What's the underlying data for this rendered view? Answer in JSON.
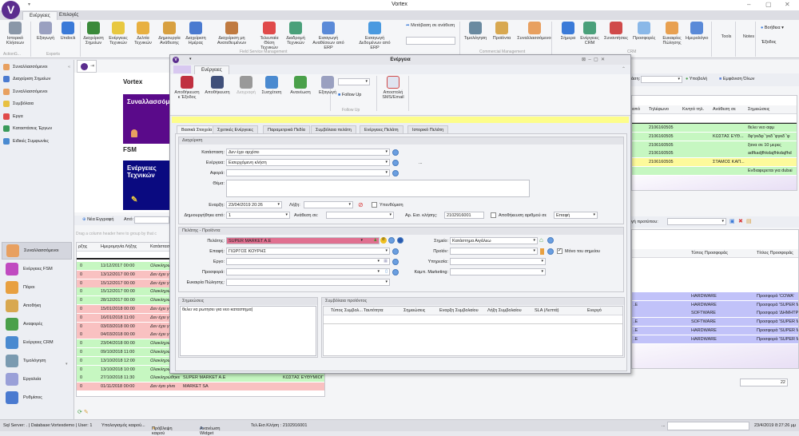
{
  "app": {
    "title": "Vortex",
    "logo": "V"
  },
  "ribbon": {
    "tabs": [
      "Ενέργειες",
      "Επιλογές"
    ],
    "buttons": [
      {
        "label": "Ιστορικό Κλήσεων",
        "icon": "phone-icon",
        "color": "#8a97a8"
      },
      {
        "label": "Εξαγωγή",
        "icon": "database-export-icon",
        "color": "#9aa0c0"
      },
      {
        "label": "Undock",
        "icon": "undock-icon",
        "color": "#3a7ad8"
      },
      {
        "label": "Διαχείριση Σημείων",
        "icon": "org-chart-icon",
        "color": "#3a8a3a"
      },
      {
        "label": "Ενέργειες Τεχνικών",
        "icon": "tools-icon",
        "color": "#e8c840"
      },
      {
        "label": "Δελτία Τεχνικών",
        "icon": "clipboard-icon",
        "color": "#e8b040"
      },
      {
        "label": "Δημιουργία Ανάθεσης",
        "icon": "assign-icon",
        "color": "#d8a040"
      },
      {
        "label": "Διαχείριση Ημέρας",
        "icon": "day-list-icon",
        "color": "#4a7ad0"
      },
      {
        "label": "Διαχείριση μη Ανατεθειμένων",
        "icon": "user-question-icon",
        "color": "#c07a40"
      },
      {
        "label": "Τελευταία Θέση Τεχνικών",
        "icon": "map-pin-icon",
        "color": "#e04a4a"
      },
      {
        "label": "Διαδρομή Τεχνικών",
        "icon": "globe-icon",
        "color": "#4aa07a"
      },
      {
        "label": "Εισαγωγή Αναθέσεων από ERP",
        "icon": "import-doc-icon",
        "color": "#5a8ad8"
      },
      {
        "label": "Εισαγωγή Δεδομένων από ERP",
        "icon": "cloud-download-icon",
        "color": "#4a9ae0"
      },
      {
        "label": "Τιμολόγηση",
        "icon": "printer-icon",
        "color": "#6a8aa0"
      },
      {
        "label": "Προϊόντα",
        "icon": "box-icon",
        "color": "#d8a850"
      },
      {
        "label": "Συναλλασσόμενοι",
        "icon": "person-icon",
        "color": "#e8a060"
      },
      {
        "label": "Σήμερα",
        "icon": "clock-icon",
        "color": "#3a7ad8"
      },
      {
        "label": "Ενέργειες CRM",
        "icon": "workflow-icon",
        "color": "#4aa07a"
      },
      {
        "label": "Συναντήσεις",
        "icon": "calendar-check-icon",
        "color": "#d04a4a"
      },
      {
        "label": "Προσφορές",
        "icon": "document-icon",
        "color": "#8ab8e8"
      },
      {
        "label": "Ευκαιρίες Πώλησης",
        "icon": "handshake-icon",
        "color": "#e8a050"
      },
      {
        "label": "Ημερολόγιο",
        "icon": "calendar-icon",
        "color": "#5a8ad8"
      },
      {
        "label": "Tools",
        "icon": "",
        "color": ""
      },
      {
        "label": "Notes",
        "icon": "",
        "color": ""
      }
    ],
    "groups": [
      "ActionG...",
      "Exports",
      "Field Service Management",
      "Commercial Management",
      "CRM"
    ],
    "transfer_label": "Μετάβαση σε ανάθεση",
    "help_label": "Βοήθεια",
    "exit_label": "Έξοδος"
  },
  "leftnav": {
    "header": "Συναλλασσόμενοι",
    "items": [
      {
        "label": "Διαχείριση Σημείων",
        "color": "#4a7ad0"
      },
      {
        "label": "Συναλλασσόμενοι",
        "color": "#e8a060"
      },
      {
        "label": "Συμβόλαια",
        "color": "#e8c040"
      },
      {
        "label": "Εργα",
        "color": "#e04a4a"
      },
      {
        "label": "Καταστάσεις Έργων",
        "color": "#3a9a5a"
      },
      {
        "label": "Ειδικές Συμφωνίες",
        "color": "#4a8ad0"
      }
    ],
    "modules": [
      {
        "label": "Συναλλασσόμενοι",
        "color": "#e8a060"
      },
      {
        "label": "Ενέργειες FSM",
        "color": "#c04ac0"
      },
      {
        "label": "Πόροι",
        "color": "#e8a040"
      },
      {
        "label": "Αποθήκη",
        "color": "#d8a850"
      },
      {
        "label": "Αναφορές",
        "color": "#4aa04a"
      },
      {
        "label": "Ενέργειες CRM",
        "color": "#4a8ad0"
      },
      {
        "label": "Τιμολόγηση",
        "color": "#7a9ab0"
      },
      {
        "label": "Εργαλεία",
        "color": "#9aa0d8"
      },
      {
        "label": "Ρυθμίσεις",
        "color": "#4a7ad0"
      }
    ]
  },
  "dashboard": {
    "vortex_heading": "Vortex",
    "tile1": "Συναλλασσόμε",
    "fsm_heading": "FSM",
    "tile2": "Ενέργειες Τεχνικών",
    "new_record": "Νέα Εγγραφή",
    "from_label": "Από:",
    "group_hint": "Drag a column header here to group by that c"
  },
  "left_grid": {
    "headers": [
      "ρξης",
      "Ημερομηνία Λήξης",
      "Κατάσταση"
    ],
    "rows": [
      {
        "c0": "0",
        "date": "11/12/2017 00:00",
        "status": "Ολοκληρώ",
        "status_color": "green"
      },
      {
        "c0": "0",
        "date": "13/12/2017 00:00",
        "status": "Δεν έχει γ",
        "status_color": "red"
      },
      {
        "c0": "0",
        "date": "15/12/2017 00:00",
        "status": "Δεν έχει γ",
        "status_color": "red"
      },
      {
        "c0": "0",
        "date": "15/12/2017 00:00",
        "status": "Ολοκληρώ",
        "status_color": "green"
      },
      {
        "c0": "0",
        "date": "28/12/2017 00:00",
        "status": "Ολοκληρώ",
        "status_color": "green"
      },
      {
        "c0": "0",
        "date": "15/01/2018 00:00",
        "status": "Δεν έχει γ",
        "status_color": "red"
      },
      {
        "c0": "0",
        "date": "16/01/2018 11:00",
        "status": "Δεν έχει γ",
        "status_color": "red"
      },
      {
        "c0": "0",
        "date": "03/03/2018 00:00",
        "status": "Δεν έχει γ",
        "status_color": "red"
      },
      {
        "c0": "0",
        "date": "04/03/2018 00:00",
        "status": "Δεν έχει γ",
        "status_color": "red"
      },
      {
        "c0": "0",
        "date": "23/04/2018 00:00",
        "status": "Ολοκληρώ",
        "status_color": "green"
      },
      {
        "c0": "0",
        "date": "09/10/2018 11:00",
        "status": "Ολοκληρώ",
        "status_color": "green"
      },
      {
        "c0": "0",
        "date": "13/10/2018 12:00",
        "status": "Ολοκληρώ",
        "status_color": "green"
      },
      {
        "c0": "0",
        "date": "13/10/2018 10:00",
        "status": "Ολοκληρώ",
        "status_color": "green"
      },
      {
        "c0": "0",
        "date": "27/10/2018 11:30",
        "status": "Ολοκληρώθηκε",
        "status_color": "green",
        "customer": "SUPER MARKET A.E",
        "assignee": "ΚΩΣΤΑΣ ΕΥΘΥΜΙΟΓ"
      },
      {
        "c0": "0",
        "date": "01/11/2018 00:00",
        "status": "Δεν έγει γίνει",
        "status_color": "red",
        "customer": "MARKET SA",
        "assignee": ""
      }
    ]
  },
  "right_grid": {
    "filter_label": "άση:",
    "submit": "Υποβολή",
    "show_all": "Εμφάνιση Όλων",
    "headers": [
      "από",
      "Τηλέφωνο",
      "Κινητό τηλ.",
      "Ανάθεση σε",
      "Σημειώσεις"
    ],
    "rows": [
      {
        "phone": "2106160505",
        "assignee": "",
        "notes": "θελει νεο αφμ",
        "color": "green"
      },
      {
        "phone": "2106160505",
        "assignee": "ΚΩΣΤΑΣ ΕΥΘ...",
        "notes": "δφ'γκδφ΄'γκδ΄'φγκδ΄'φ",
        "color": "green"
      },
      {
        "phone": "2106160505",
        "assignee": "",
        "notes": "ξανα σε 10 μερες",
        "color": "green"
      },
      {
        "phone": "2106160505",
        "assignee": "",
        "notes": "adfkadjfhkdajfhkdajfhd",
        "color": "green"
      },
      {
        "phone": "2106160505",
        "assignee": "ΣΤΑΜΟΣ ΚΑΠ...",
        "notes": "",
        "color": "yellow"
      },
      {
        "phone": "",
        "assignee": "",
        "notes": "Ενδιαφερεται για dubai",
        "color": "green"
      }
    ]
  },
  "offers_grid": {
    "template_label": "γή προτύπου:",
    "headers": [
      "Τύπος Προσφοράς",
      "Τίτλος Προσφοράς"
    ],
    "rows": [
      {
        "c0": "",
        "type": "HARDWARE",
        "title": "Προσφορά 'COWA'"
      },
      {
        "c0": ".E",
        "type": "HARDWARE",
        "title": "Προσφορά 'SUPER MAR"
      },
      {
        "c0": "",
        "type": "SOFTWARE",
        "title": "Προσφορά 'ΔΗΜΗΤΡΗΣ"
      },
      {
        "c0": ".E",
        "type": "SOFTWARE",
        "title": "Προσφορά 'SUPER MAR"
      },
      {
        "c0": ".E",
        "type": "HARDWARE",
        "title": "Προσφορά 'SUPER MAR"
      },
      {
        "c0": ".E",
        "type": "HARDWARE",
        "title": "Προσφορά 'SUPER MAR"
      }
    ],
    "count": "22"
  },
  "dialog": {
    "title": "Ενέργεια",
    "tab": "Ενέργειες",
    "buttons": [
      "Αποθήκευση κ Έξοδος",
      "Αποθήκευση",
      "Διαγραφή",
      "Συσχέτιση",
      "Ανανέωση",
      "Εξαγωγή"
    ],
    "follow_up_btn": "Follow Up",
    "follow_up_group": "Follow Up",
    "send_btn": "Αποστολή SMS/Email",
    "tabs": [
      "Βασικά Στοιχεία",
      "Σχετικές Ενέργειες",
      "Παραμετρικά Πεδία",
      "Συμβόλαια πελάτη",
      "Ενέργειες Πελάτη",
      "Ιστορικό Πελάτη"
    ],
    "management": {
      "title": "Διαχείριση",
      "status_label": "Κατάσταση:",
      "status_value": "Δεν έχει αρχίσει",
      "action_label": "Ενέργεια:",
      "action_value": "Εισερχόμενη κλήση",
      "concern_label": "Αφορά:",
      "concern_value": "",
      "subject_label": "Θέμα:",
      "subject_value": "",
      "start_label": "Εναρξη:",
      "start_value": "23/04/2019 20:26",
      "end_label": "Λήξη:",
      "end_value": "",
      "reminder_label": "Υπενθύμιση",
      "created_by_label": "Δημιουργήθηκε από:",
      "created_by_value": "1",
      "assign_label": "Ανάθεση σε:",
      "assign_value": "",
      "call_no_label": "Αρ. Εισ. κλήσης:",
      "call_no_value": "2102916001",
      "save_no_label": "Αποθήκευση αριθμού σε",
      "save_no_value": "Επαφή",
      "ellipsis": "..."
    },
    "customer": {
      "title": "Πελάτης - Προϊόντα",
      "customer_label": "Πελάτης:",
      "customer_value": "SUPER MARKET A.E",
      "contact_label": "Επαφή:",
      "contact_value": "ΓΙΩΡΓΟΣ ΚΟΥΡΗΣ",
      "project_label": "Εργο:",
      "project_value": "",
      "offer_label": "Προσφορά:",
      "offer_value": "",
      "opportunity_label": "Ευκαιρία Πώλησης:",
      "opportunity_value": "",
      "point_label": "Σημείο:",
      "point_value": "Κατάστημα Αιγάλεω",
      "product_label": "Προϊόν:",
      "product_value": "",
      "only_point_label": "Μόνο του σημείου",
      "service_label": "Υπηρεσία:",
      "service_value": "",
      "campaign_label": "Καμπ. Marketing:",
      "campaign_value": ""
    },
    "notes": {
      "title": "Σημειώσεις",
      "value": "θελει να ρωτησει για νεο καταστημα"
    },
    "contracts": {
      "title": "Συμβόλαια προϊόντος",
      "headers": [
        "Τύπος Συμβολ...",
        "Ταυτότητα",
        "Σημειώσεις",
        "Εναρξη Συμβολαίου",
        "Λήξη Συμβολαίου",
        "SLA (Λεπτά)",
        "Ενεργό"
      ]
    }
  },
  "statusbar": {
    "server": "Sql Server: . | Database:Vortexdemo | User: 1",
    "weather_calc": "Υπολογισμός καιρού...",
    "forecast": "Πρόβλεψη καιρού",
    "refresh": "Ανανέωση Widget",
    "last_call": "Τελ.Εισ.Κλήση :   2102916001",
    "dots": "...",
    "datetime": "23/4/2019 8:27:26 μμ"
  }
}
